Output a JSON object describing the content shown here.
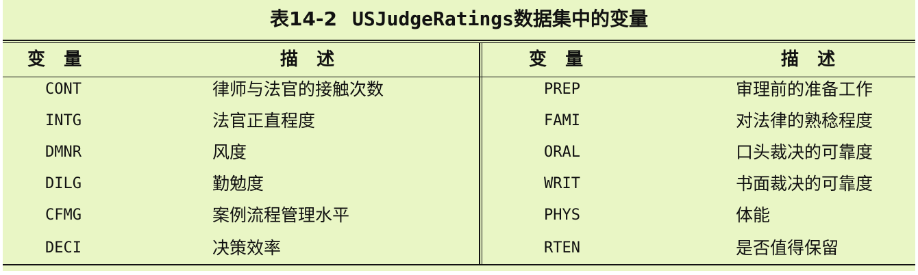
{
  "caption": {
    "prefix": "表14-2",
    "dataset": "USJudgeRatings",
    "suffix": "数据集中的变量"
  },
  "headers": {
    "variable": "变   量",
    "description": "描   述"
  },
  "left_rows": [
    {
      "code": "CONT",
      "desc": "律师与法官的接触次数"
    },
    {
      "code": "INTG",
      "desc": "法官正直程度"
    },
    {
      "code": "DMNR",
      "desc": "风度"
    },
    {
      "code": "DILG",
      "desc": "勤勉度"
    },
    {
      "code": "CFMG",
      "desc": "案例流程管理水平"
    },
    {
      "code": "DECI",
      "desc": "决策效率"
    }
  ],
  "right_rows": [
    {
      "code": "PREP",
      "desc": "审理前的准备工作"
    },
    {
      "code": "FAMI",
      "desc": "对法律的熟稔程度"
    },
    {
      "code": "ORAL",
      "desc": "口头裁决的可靠度"
    },
    {
      "code": "WRIT",
      "desc": "书面裁决的可靠度"
    },
    {
      "code": "PHYS",
      "desc": "体能"
    },
    {
      "code": "RTEN",
      "desc": "是否值得保留"
    }
  ],
  "colors": {
    "background": "#e9f6c5",
    "text": "#111111"
  }
}
